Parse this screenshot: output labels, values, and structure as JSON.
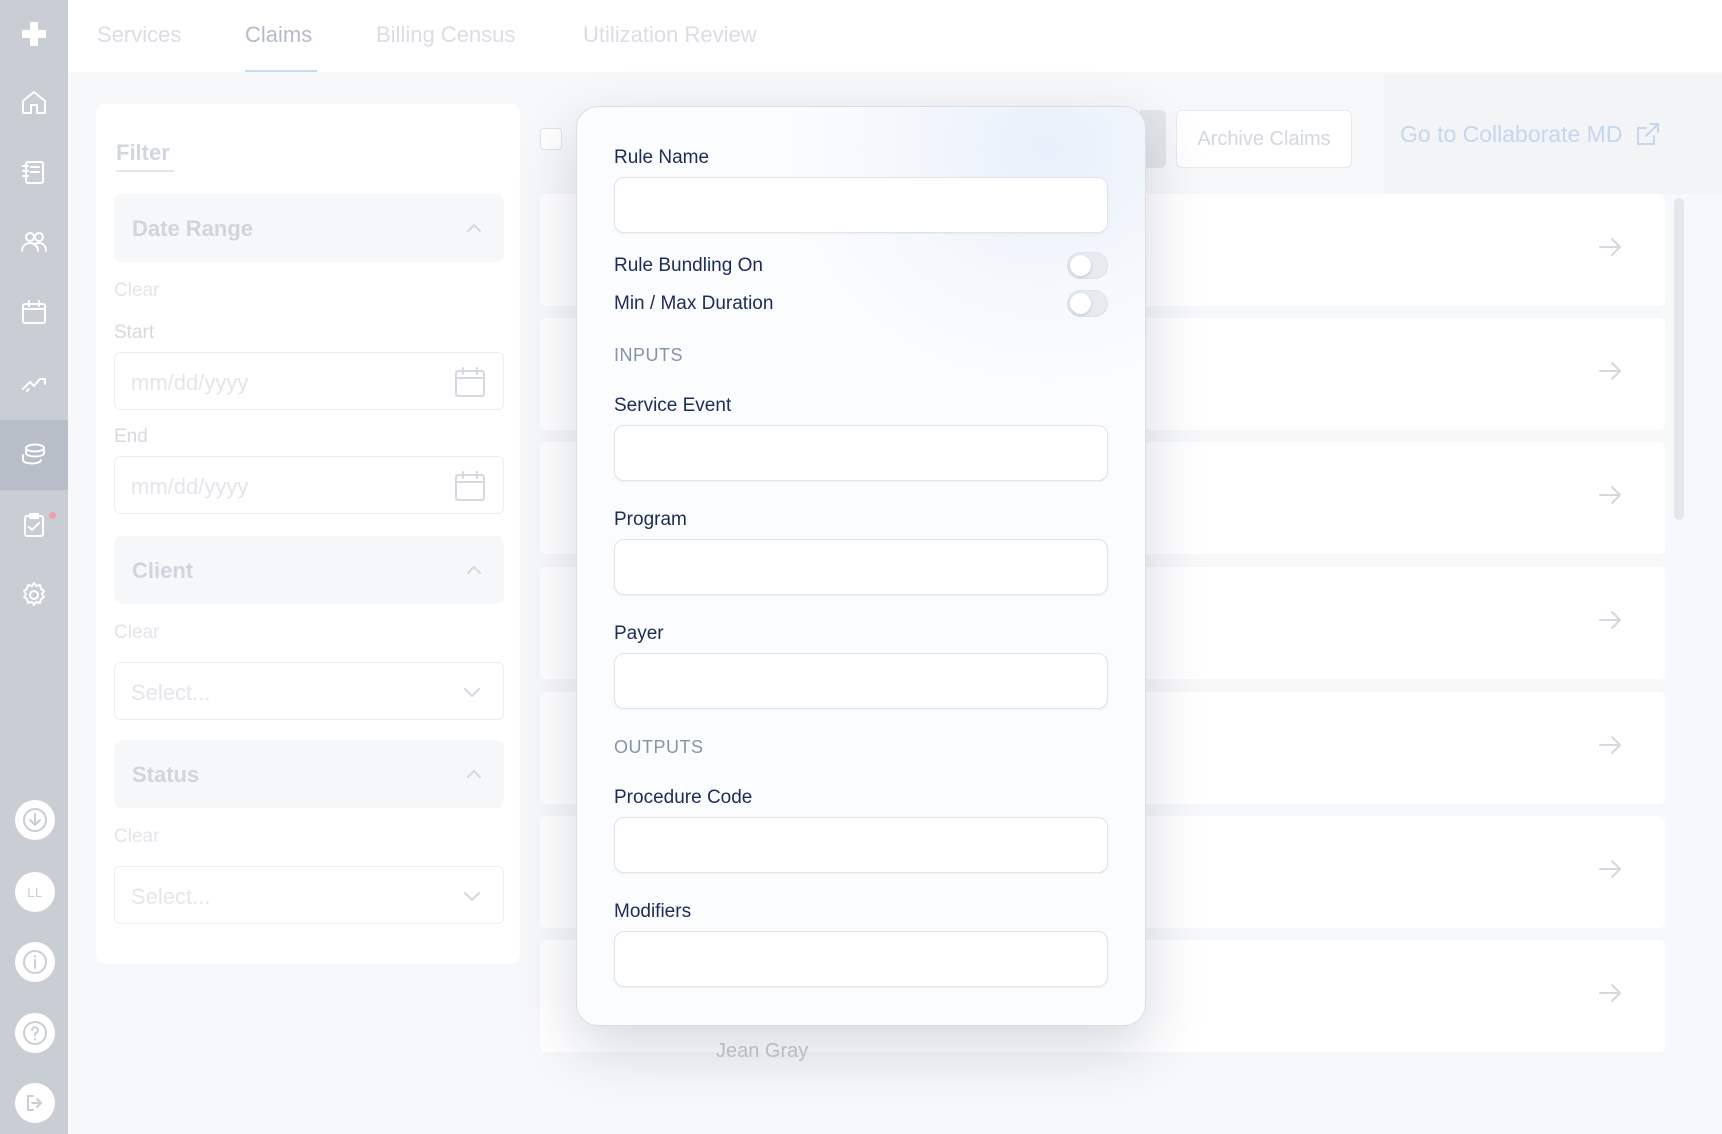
{
  "nav": {
    "tabs": [
      {
        "label": "Services"
      },
      {
        "label": "Claims"
      },
      {
        "label": "Billing Census"
      },
      {
        "label": "Utilization Review"
      }
    ],
    "active_tab": "Claims",
    "avatar_initials": "LL"
  },
  "filter": {
    "title": "Filter",
    "date_range": {
      "label": "Date Range",
      "clear": "Clear",
      "start_label": "Start",
      "start_placeholder": "mm/dd/yyyy",
      "end_label": "End",
      "end_placeholder": "mm/dd/yyyy"
    },
    "client": {
      "label": "Client",
      "clear": "Clear",
      "placeholder": "Select..."
    },
    "status": {
      "label": "Status",
      "clear": "Clear",
      "placeholder": "Select..."
    }
  },
  "toolbar": {
    "archive_label": "Archive Claims",
    "collaborate_link": "Go to Collaborate MD"
  },
  "list": {
    "peek_text": "Jean Gray"
  },
  "modal": {
    "rule_name_label": "Rule Name",
    "rule_name_value": "",
    "rule_bundling_label": "Rule Bundling On",
    "rule_bundling_on": false,
    "min_max_label": "Min / Max Duration",
    "min_max_on": false,
    "inputs_header": "INPUTS",
    "service_event_label": "Service Event",
    "service_event_value": "",
    "program_label": "Program",
    "program_value": "",
    "payer_label": "Payer",
    "payer_value": "",
    "outputs_header": "OUTPUTS",
    "procedure_code_label": "Procedure Code",
    "procedure_code_value": "",
    "modifiers_label": "Modifiers",
    "modifiers_value": ""
  },
  "colors": {
    "rail": "#c9cdd4",
    "text_primary": "#1c2b57",
    "section_header": "#8593aa",
    "accent_link": "#c4d6f0"
  },
  "icons": [
    "plus-logo-icon",
    "home-icon",
    "notebook-icon",
    "users-icon",
    "calendar-icon",
    "trend-icon",
    "billing-icon",
    "clipboard-check-icon",
    "gear-icon",
    "download-icon",
    "info-icon",
    "help-icon",
    "logout-icon",
    "chevron-up-icon",
    "chevron-down-icon",
    "arrow-right-icon",
    "external-link-icon"
  ]
}
